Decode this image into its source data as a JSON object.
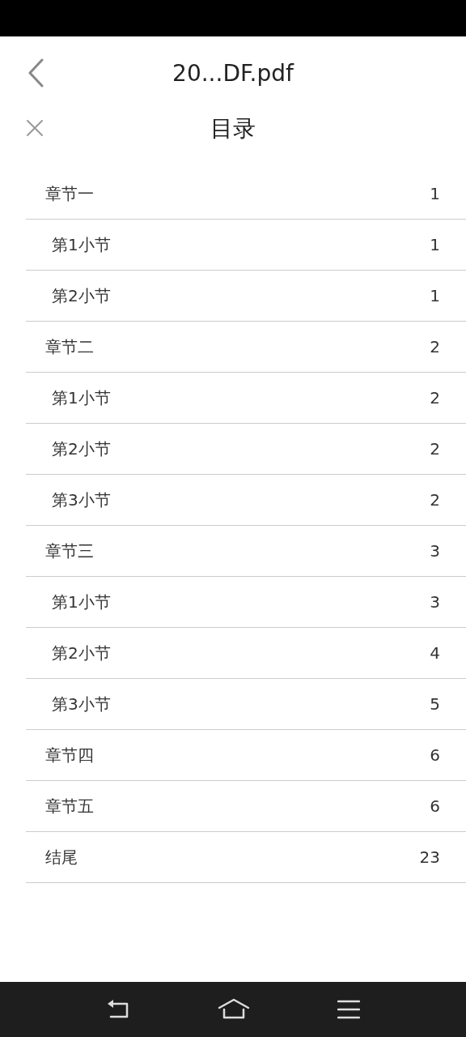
{
  "header": {
    "title": "20...DF.pdf"
  },
  "panel": {
    "title": "目录"
  },
  "toc": [
    {
      "label": "章节一",
      "page": "1",
      "children": [
        {
          "label": "第1小节",
          "page": "1"
        },
        {
          "label": "第2小节",
          "page": "1"
        }
      ]
    },
    {
      "label": "章节二",
      "page": "2",
      "children": [
        {
          "label": "第1小节",
          "page": "2"
        },
        {
          "label": "第2小节",
          "page": "2"
        },
        {
          "label": "第3小节",
          "page": "2"
        }
      ]
    },
    {
      "label": "章节三",
      "page": "3",
      "children": [
        {
          "label": "第1小节",
          "page": "3"
        },
        {
          "label": "第2小节",
          "page": "4"
        },
        {
          "label": "第3小节",
          "page": "5"
        }
      ]
    },
    {
      "label": "章节四",
      "page": "6"
    },
    {
      "label": "章节五",
      "page": "6"
    },
    {
      "label": "结尾",
      "page": "23"
    }
  ]
}
